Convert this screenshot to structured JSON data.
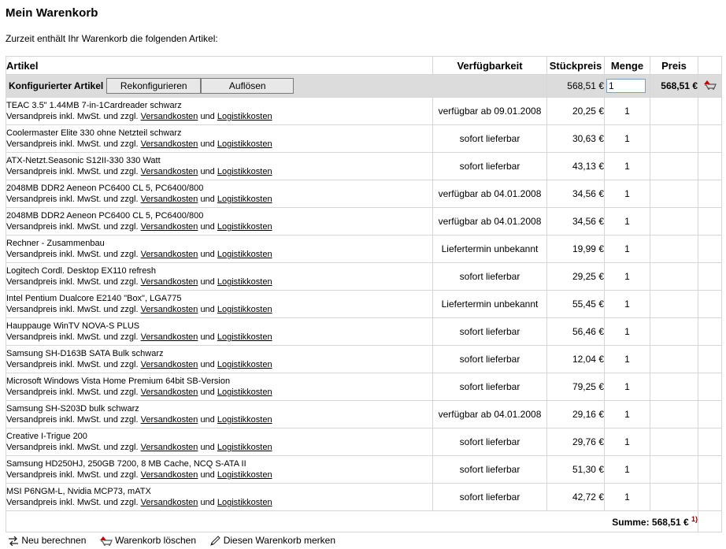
{
  "page": {
    "title": "Mein Warenkorb",
    "intro": "Zurzeit enthält Ihr Warenkorb die folgenden Artikel:"
  },
  "table": {
    "headers": {
      "artikel": "Artikel",
      "verfuegbarkeit": "Verfügbarkeit",
      "stueckpreis": "Stückpreis",
      "menge": "Menge",
      "preis": "Preis"
    },
    "config": {
      "label": "Konfigurierter Artikel",
      "rekonfigurieren": "Rekonfigurieren",
      "aufloesen": "Auflösen",
      "unit_price": "568,51 €",
      "quantity": "1",
      "total": "568,51 €"
    },
    "shipping_text_prefix": "Versandpreis inkl. MwSt. und zzgl.",
    "shipping_link": "Versandkosten",
    "and_text": "und",
    "logistics_link": "Logistikkosten",
    "items": [
      {
        "name": "TEAC 3.5\" 1.44MB 7-in-1Cardreader schwarz",
        "availability": "verfügbar ab 09.01.2008",
        "price": "20,25 €",
        "qty": "1"
      },
      {
        "name": "Coolermaster Elite 330 ohne Netzteil schwarz",
        "availability": "sofort lieferbar",
        "price": "30,63 €",
        "qty": "1"
      },
      {
        "name": "ATX-Netzt.Seasonic S12II-330 330 Watt",
        "availability": "sofort lieferbar",
        "price": "43,13 €",
        "qty": "1"
      },
      {
        "name": "2048MB DDR2 Aeneon PC6400 CL 5, PC6400/800",
        "availability": "verfügbar ab 04.01.2008",
        "price": "34,56 €",
        "qty": "1"
      },
      {
        "name": "2048MB DDR2 Aeneon PC6400 CL 5, PC6400/800",
        "availability": "verfügbar ab 04.01.2008",
        "price": "34,56 €",
        "qty": "1"
      },
      {
        "name": "Rechner - Zusammenbau",
        "availability": "Liefertermin unbekannt",
        "price": "19,99 €",
        "qty": "1"
      },
      {
        "name": "Logitech Cordl. Desktop EX110 refresh",
        "availability": "sofort lieferbar",
        "price": "29,25 €",
        "qty": "1"
      },
      {
        "name": "Intel Pentium Dualcore E2140 \"Box\", LGA775",
        "availability": "Liefertermin unbekannt",
        "price": "55,45 €",
        "qty": "1"
      },
      {
        "name": "Hauppauge WinTV NOVA-S PLUS",
        "availability": "sofort lieferbar",
        "price": "56,46 €",
        "qty": "1"
      },
      {
        "name": "Samsung SH-D163B SATA Bulk schwarz",
        "availability": "sofort lieferbar",
        "price": "12,04 €",
        "qty": "1"
      },
      {
        "name": "Microsoft Windows Vista Home Premium 64bit SB-Version",
        "availability": "sofort lieferbar",
        "price": "79,25 €",
        "qty": "1"
      },
      {
        "name": "Samsung SH-S203D bulk schwarz",
        "availability": "verfügbar ab 04.01.2008",
        "price": "29,16 €",
        "qty": "1"
      },
      {
        "name": "Creative I-Trigue 200",
        "availability": "sofort lieferbar",
        "price": "29,76 €",
        "qty": "1"
      },
      {
        "name": "Samsung HD250HJ, 250GB 7200, 8 MB Cache, NCQ S-ATA II",
        "availability": "sofort lieferbar",
        "price": "51,30 €",
        "qty": "1"
      },
      {
        "name": "MSI P6NGM-L, Nvidia MCP73, mATX",
        "availability": "sofort lieferbar",
        "price": "42,72 €",
        "qty": "1"
      }
    ],
    "sum_label": "Summe: 568,51 €",
    "footnote": "1)"
  },
  "actions": {
    "recalc": "Neu berechnen",
    "delete": "Warenkorb löschen",
    "remember": "Diesen Warenkorb merken"
  },
  "icons": {
    "remove": "cart-remove-icon",
    "recalc": "recalc-arrows-icon",
    "delete": "cart-delete-icon",
    "remember": "pencil-icon"
  },
  "colors": {
    "config_row_bg": "#dcdcdc",
    "border": "#d6d6d6",
    "icon_red": "#cc0000"
  }
}
